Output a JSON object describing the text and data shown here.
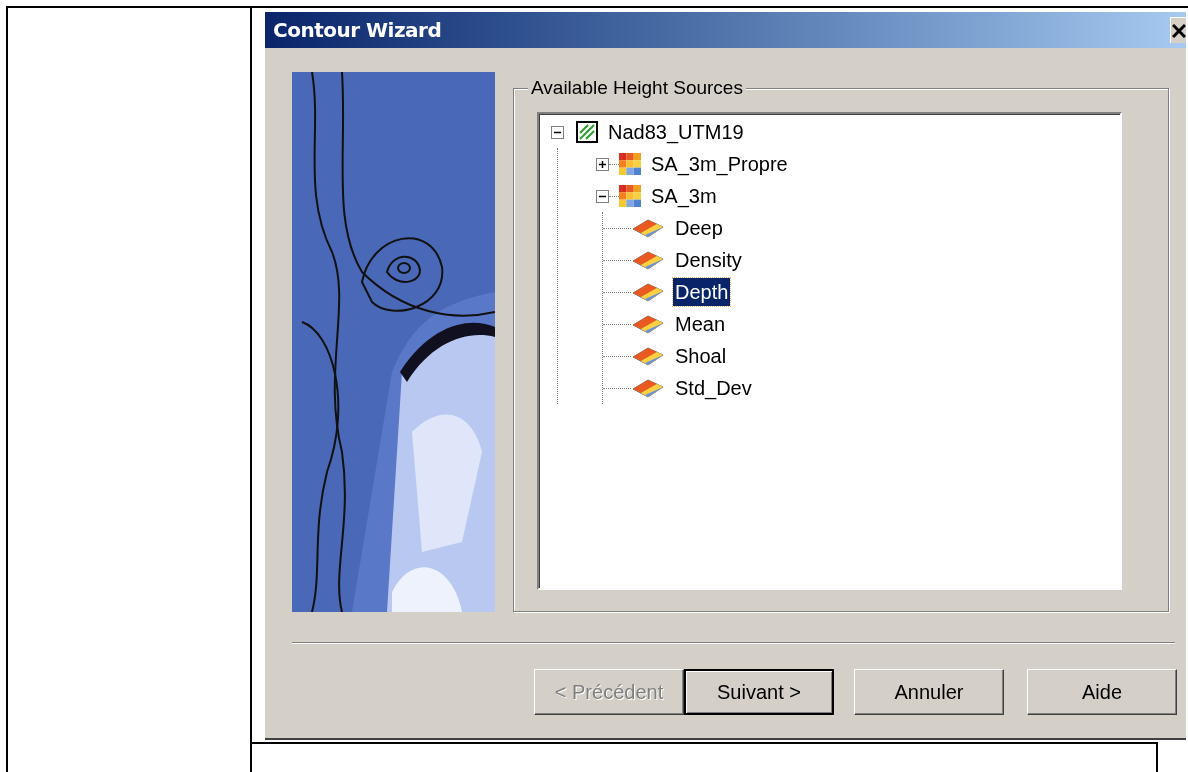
{
  "window": {
    "title": "Contour Wizard"
  },
  "group": {
    "legend": "Available Height Sources"
  },
  "tree": [
    {
      "label": "Nad83_UTM19",
      "kind": "frame",
      "expanded": true,
      "selected": false,
      "children": [
        {
          "label": "SA_3m_Propre",
          "kind": "raster",
          "expanded": false,
          "selected": false
        },
        {
          "label": "SA_3m",
          "kind": "raster",
          "expanded": true,
          "selected": false,
          "children": [
            {
              "label": "Deep",
              "kind": "surface",
              "selected": false
            },
            {
              "label": "Density",
              "kind": "surface",
              "selected": false
            },
            {
              "label": "Depth",
              "kind": "surface",
              "selected": true
            },
            {
              "label": "Mean",
              "kind": "surface",
              "selected": false
            },
            {
              "label": "Shoal",
              "kind": "surface",
              "selected": false
            },
            {
              "label": "Std_Dev",
              "kind": "surface",
              "selected": false
            }
          ]
        }
      ]
    }
  ],
  "buttons": [
    {
      "label": "< Précédent",
      "disabled": true,
      "default": false
    },
    {
      "label": "Suivant >",
      "disabled": false,
      "default": true
    },
    {
      "label": "Annuler",
      "disabled": false,
      "default": false
    },
    {
      "label": "Aide",
      "disabled": false,
      "default": false
    }
  ]
}
